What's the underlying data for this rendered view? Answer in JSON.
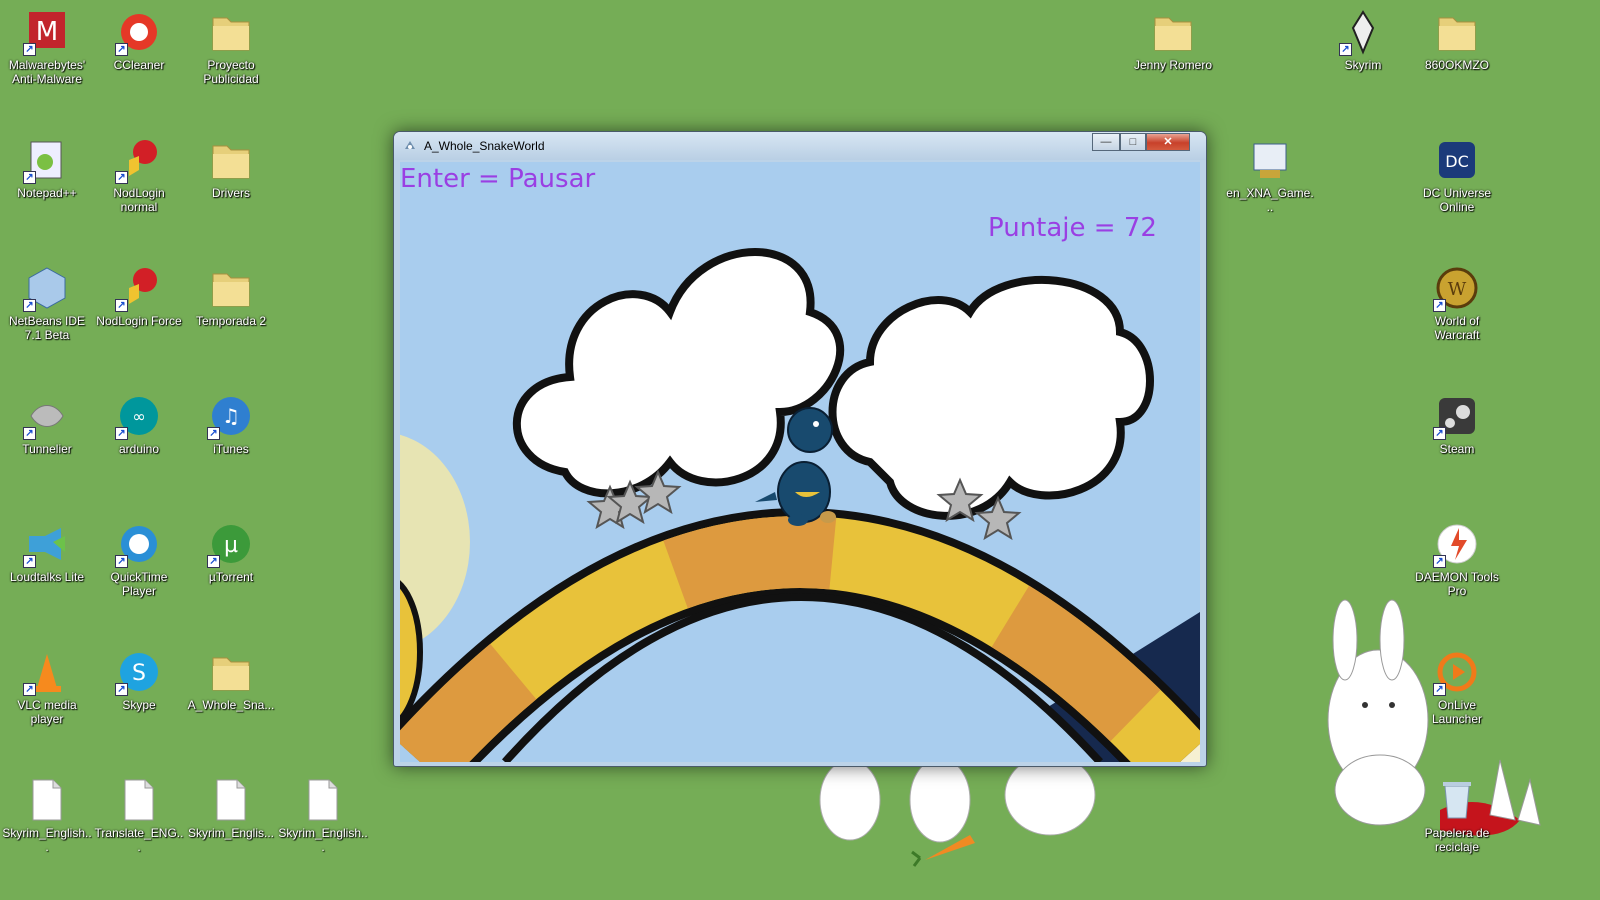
{
  "desktop": {
    "icons_left": [
      {
        "label": "Malwarebytes' Anti-Malware",
        "icon": "malwarebytes-icon"
      },
      {
        "label": "CCleaner",
        "icon": "ccleaner-icon"
      },
      {
        "label": "Proyecto Publicidad",
        "icon": "folder-icon"
      },
      {
        "label": "Notepad++",
        "icon": "notepad-plus-plus-icon"
      },
      {
        "label": "NodLogin normal",
        "icon": "nodlogin-icon"
      },
      {
        "label": "Drivers",
        "icon": "folder-icon"
      },
      {
        "label": "NetBeans IDE 7.1 Beta",
        "icon": "netbeans-icon"
      },
      {
        "label": "NodLogin Force",
        "icon": "nodlogin-icon"
      },
      {
        "label": "Temporada 2",
        "icon": "folder-icon"
      },
      {
        "label": "Tunnelier",
        "icon": "tunnelier-icon"
      },
      {
        "label": "arduino",
        "icon": "arduino-icon"
      },
      {
        "label": "iTunes",
        "icon": "itunes-icon"
      },
      {
        "label": "Loudtalks Lite",
        "icon": "loudtalks-icon"
      },
      {
        "label": "QuickTime Player",
        "icon": "quicktime-icon"
      },
      {
        "label": "µTorrent",
        "icon": "utorrent-icon"
      },
      {
        "label": "VLC media player",
        "icon": "vlc-icon"
      },
      {
        "label": "Skype",
        "icon": "skype-icon"
      },
      {
        "label": "A_Whole_Sna...",
        "icon": "folder-icon"
      },
      {
        "label": "Skyrim_English...",
        "icon": "document-icon"
      },
      {
        "label": "Translate_ENG...",
        "icon": "document-icon"
      },
      {
        "label": "Skyrim_Englis...",
        "icon": "document-icon"
      },
      {
        "label": "Skyrim_English...",
        "icon": "document-icon"
      }
    ],
    "icons_right": [
      {
        "label": "Jenny Romero",
        "icon": "folder-icon"
      },
      {
        "label": "Skyrim",
        "icon": "skyrim-icon"
      },
      {
        "label": "860OKMZO",
        "icon": "folder-icon"
      },
      {
        "label": "en_XNA_Game...",
        "icon": "installer-icon"
      },
      {
        "label": "DC Universe Online",
        "icon": "dc-universe-icon"
      },
      {
        "label": "World of Warcraft",
        "icon": "warcraft-icon"
      },
      {
        "label": "Steam",
        "icon": "steam-icon"
      },
      {
        "label": "DAEMON Tools Pro",
        "icon": "daemon-tools-icon"
      },
      {
        "label": "OnLive Launcher",
        "icon": "onlive-icon"
      },
      {
        "label": "Papelera de reciclaje",
        "icon": "recycle-bin-icon"
      }
    ]
  },
  "window": {
    "title": "A_Whole_SnakeWorld",
    "minimize_label": "—",
    "maximize_label": "□",
    "close_label": "✕"
  },
  "game": {
    "pause_hint": "Enter = Pausar",
    "score_text": "Puntaje = 72"
  },
  "colors": {
    "desktop_bg": "#75ad56",
    "hud_text": "#9a3fe3",
    "sky": "#a9cdee",
    "arc_yellow": "#e8c23a",
    "arc_orange": "#dd9a3f"
  }
}
